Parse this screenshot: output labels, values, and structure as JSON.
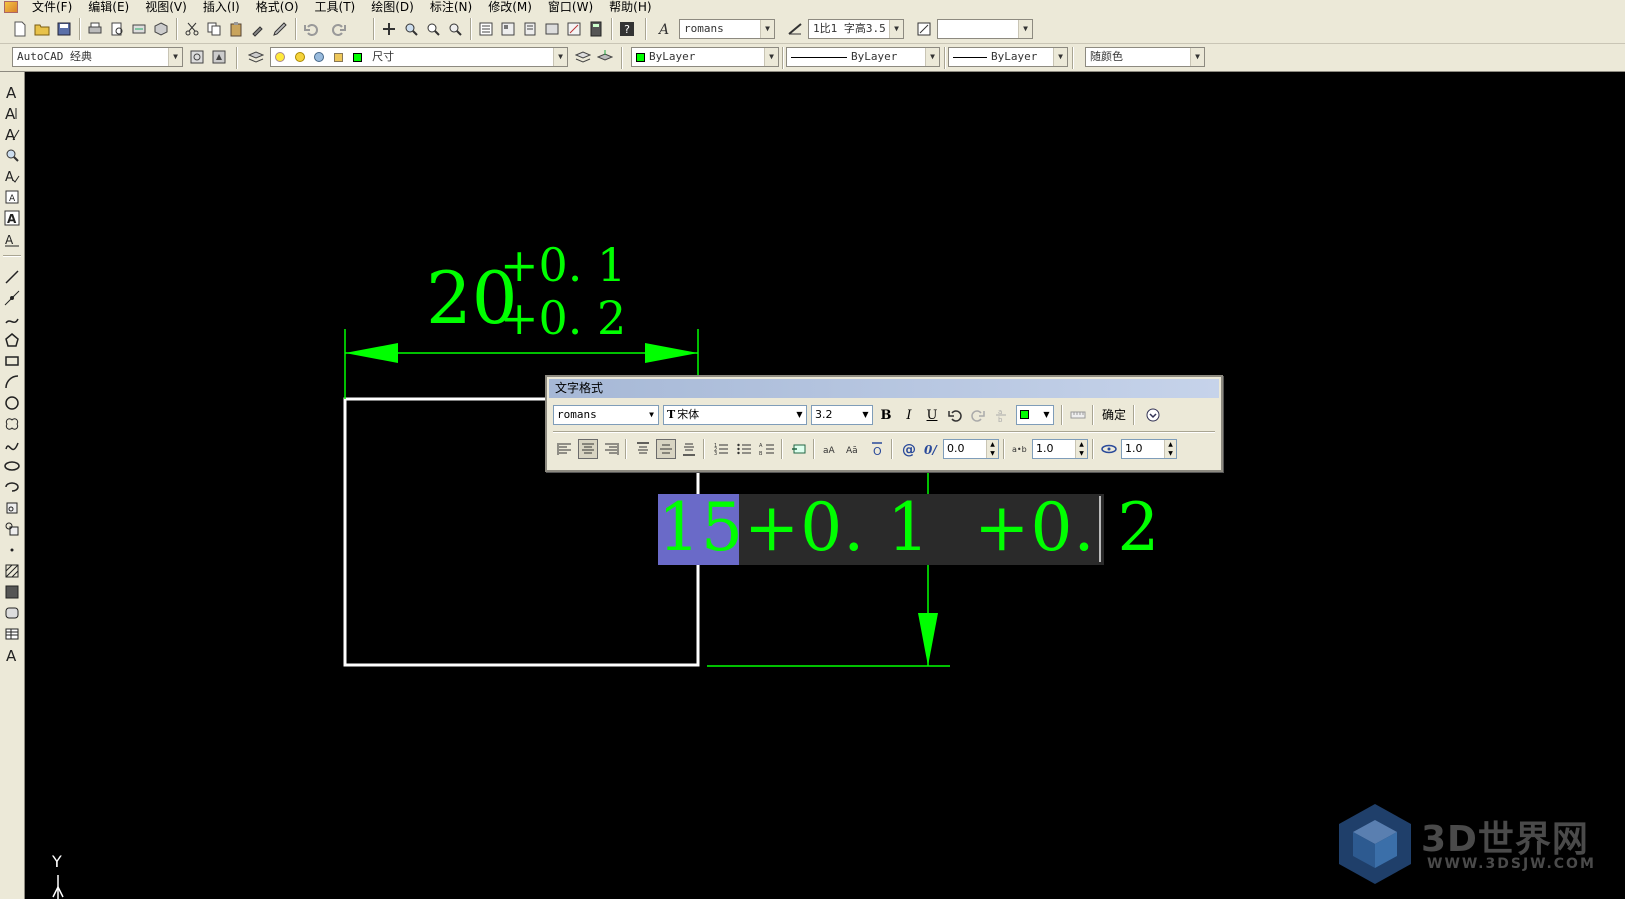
{
  "menu": {
    "items": [
      "文件(F)",
      "编辑(E)",
      "视图(V)",
      "插入(I)",
      "格式(O)",
      "工具(T)",
      "绘图(D)",
      "标注(N)",
      "修改(M)",
      "窗口(W)",
      "帮助(H)"
    ]
  },
  "toolbar": {
    "text_style": "romans",
    "annotation_scale": "1比1 字高3.5",
    "extra_combo": "",
    "workspace": "AutoCAD 经典",
    "layer": "尺寸",
    "color": "ByLayer",
    "linetype": "ByLayer",
    "lineweight": "ByLayer",
    "plotstyle": "随颜色"
  },
  "colors": {
    "accent_green": "#00ff00",
    "geometry_white": "#ffffff",
    "selection": "#6a6ac8",
    "canvas": "#000000"
  },
  "drawing": {
    "top_dim_value": "20",
    "top_dim_upper_tol": "+0. 1",
    "top_dim_lower_tol": "+0. 2"
  },
  "text_format": {
    "title": "文字格式",
    "style": "romans",
    "font": "宋体",
    "height": "3.2",
    "bold": "B",
    "italic": "I",
    "underline": "U",
    "ok_label": "确定",
    "oblique_angle": "0.0",
    "tracking": "1.0",
    "width_factor": "1.0"
  },
  "mtext": {
    "selected": "15",
    "rest": "+0. 1  +0. 2"
  },
  "ucs": {
    "y_label": "Y"
  },
  "watermark": {
    "brand": "3D世界网",
    "url": "WWW.3DSJW.COM"
  }
}
